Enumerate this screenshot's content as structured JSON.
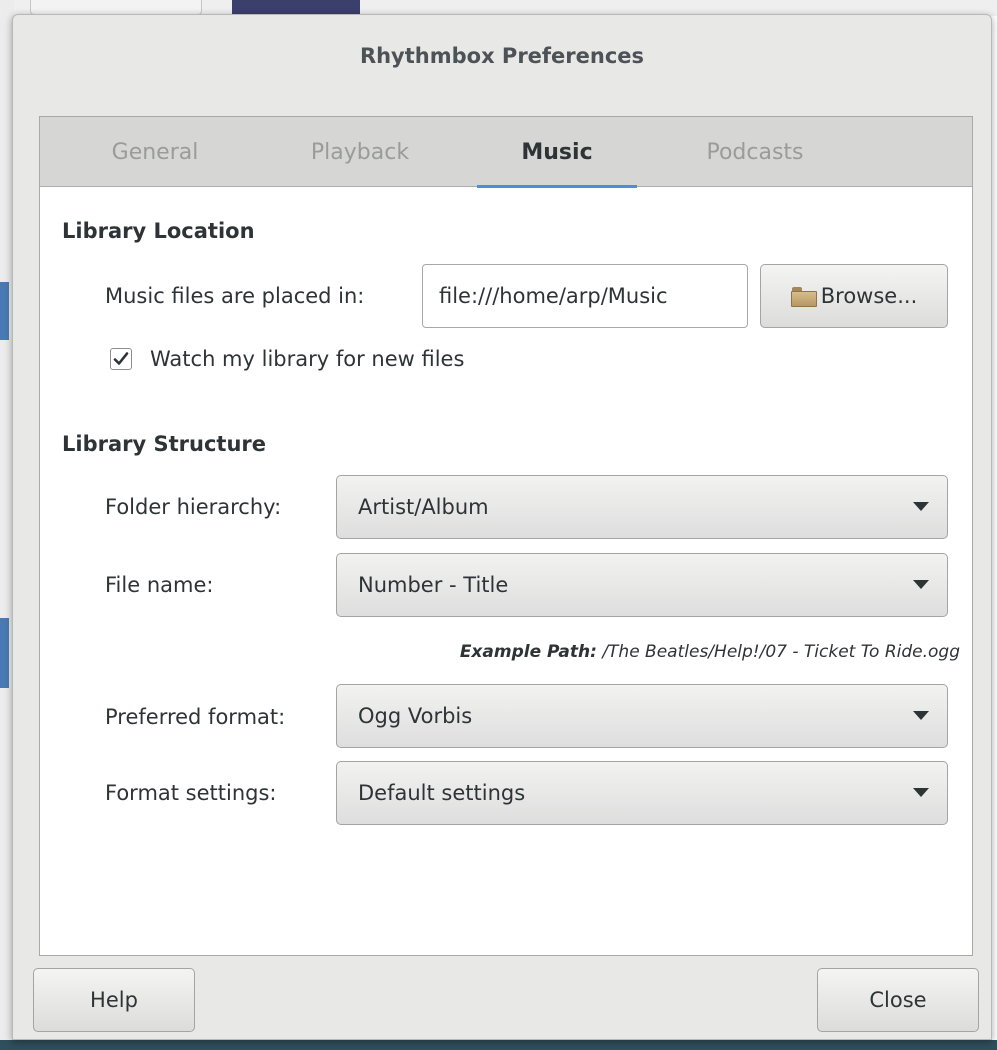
{
  "window": {
    "title": "Rhythmbox Preferences"
  },
  "tabs": [
    {
      "label": "General",
      "active": false
    },
    {
      "label": "Playback",
      "active": false
    },
    {
      "label": "Music",
      "active": true
    },
    {
      "label": "Podcasts",
      "active": false
    }
  ],
  "library_location": {
    "heading": "Library Location",
    "path_label": "Music files are placed in:",
    "path_value": "file:///home/arp/Music",
    "browse_label": "Browse...",
    "browse_icon": "folder-icon",
    "watch_label": "Watch my library for new files",
    "watch_checked": true
  },
  "library_structure": {
    "heading": "Library Structure",
    "folder_hierarchy_label": "Folder hierarchy:",
    "folder_hierarchy_value": "Artist/Album",
    "file_name_label": "File name:",
    "file_name_value": "Number - Title",
    "example_label": "Example Path:",
    "example_value": "/The Beatles/Help!/07 - Ticket To Ride.ogg",
    "preferred_format_label": "Preferred format:",
    "preferred_format_value": "Ogg Vorbis",
    "format_settings_label": "Format settings:",
    "format_settings_value": "Default settings"
  },
  "footer": {
    "help_label": "Help",
    "close_label": "Close"
  },
  "colors": {
    "active_tab_underline": "#4a90d9",
    "dialog_background": "#e8e8e7",
    "tab_bar_background": "#d6d6d5"
  }
}
